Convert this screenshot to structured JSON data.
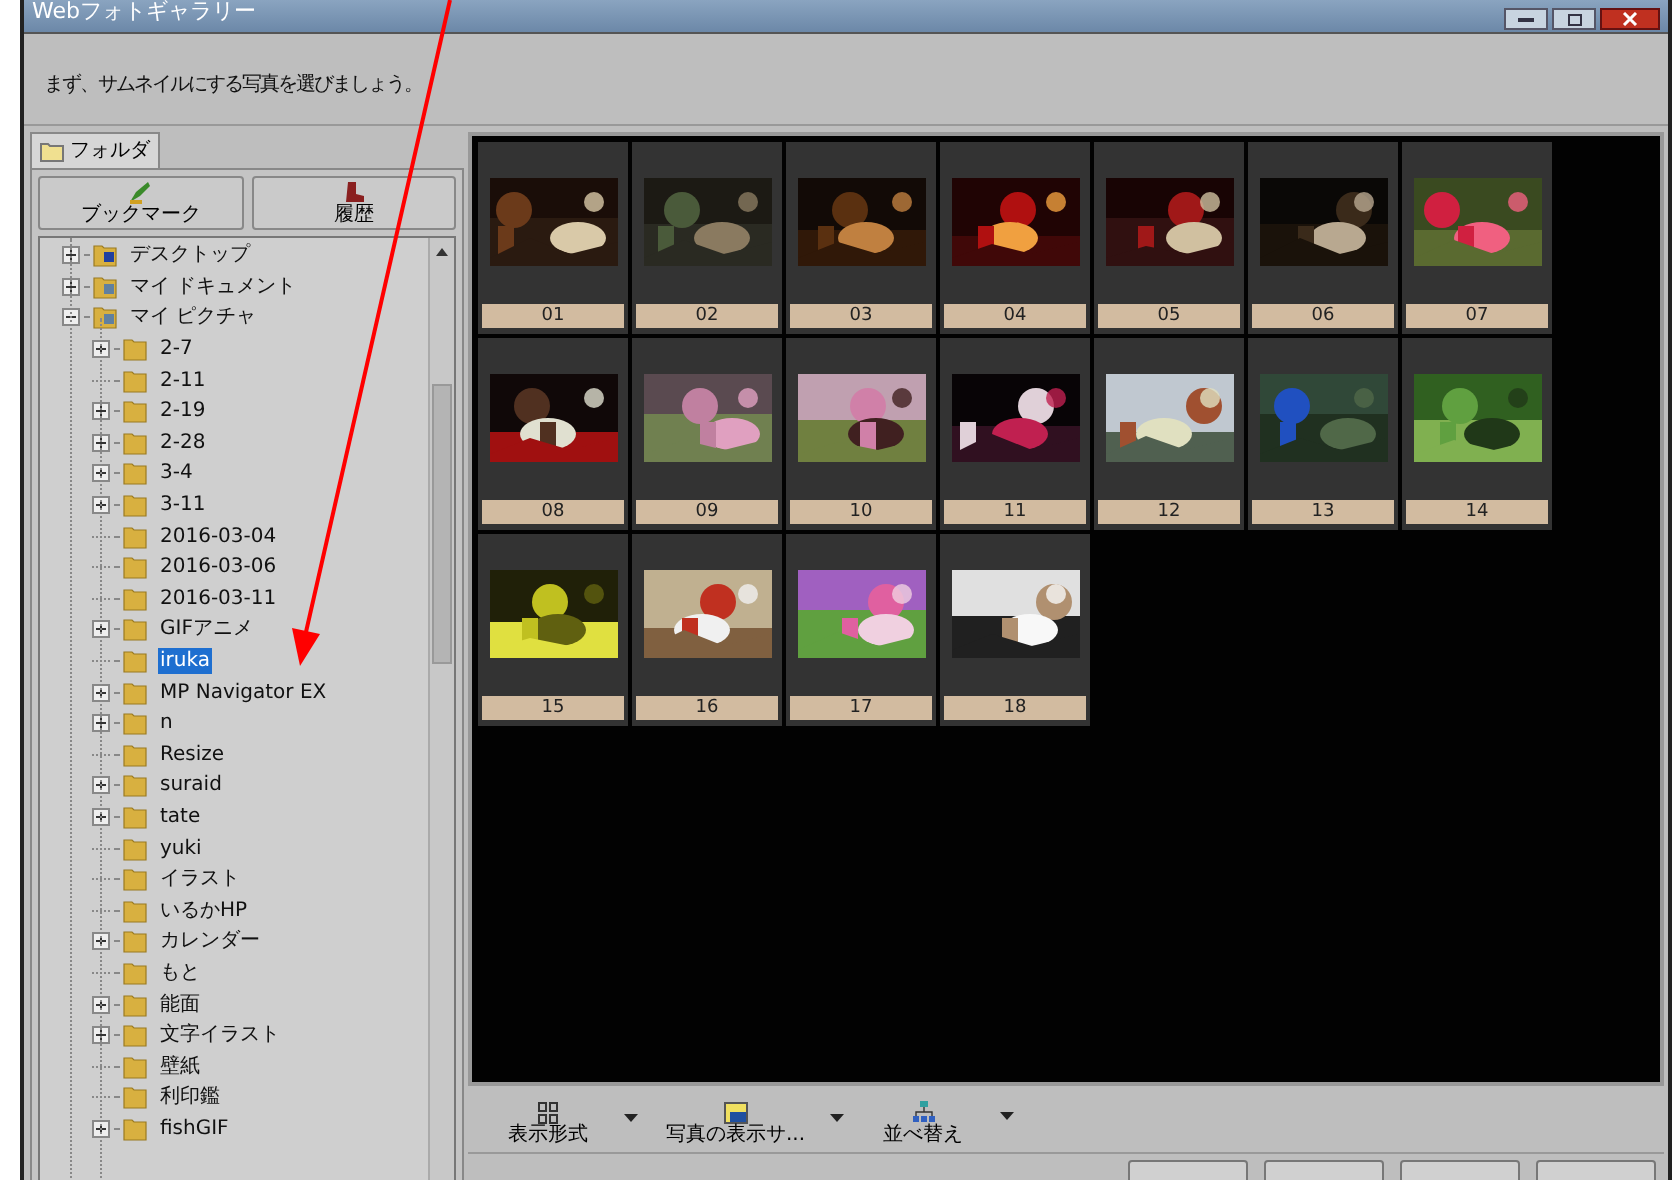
{
  "window": {
    "title": "Webフォトギャラリー"
  },
  "instruction": "まず、サムネイルにする写真を選びましょう。",
  "panel_tab": {
    "label": "フォルダ",
    "selected": true
  },
  "panel_buttons": [
    {
      "label": "ブックマーク",
      "kind": "bookmark"
    },
    {
      "label": "履歴",
      "kind": "history"
    }
  ],
  "tree": [
    {
      "label": "デスクトップ",
      "expandable": true,
      "expanded": false,
      "selected": false,
      "kind": "desktop"
    },
    {
      "label": "マイ ドキュメント",
      "expandable": true,
      "expanded": false,
      "selected": false,
      "kind": "documents"
    },
    {
      "label": "マイ ピクチャ",
      "expandable": true,
      "expanded": true,
      "selected": false,
      "kind": "pictures",
      "children": [
        {
          "label": "2-7",
          "expandable": true,
          "selected": false
        },
        {
          "label": "2-11",
          "expandable": false,
          "selected": false
        },
        {
          "label": "2-19",
          "expandable": true,
          "selected": false
        },
        {
          "label": "2-28",
          "expandable": true,
          "selected": false
        },
        {
          "label": "3-4",
          "expandable": true,
          "selected": false
        },
        {
          "label": "3-11",
          "expandable": true,
          "selected": false
        },
        {
          "label": "2016-03-04",
          "expandable": false,
          "selected": false
        },
        {
          "label": "2016-03-06",
          "expandable": false,
          "selected": false
        },
        {
          "label": "2016-03-11",
          "expandable": false,
          "selected": false
        },
        {
          "label": "GIFアニメ",
          "expandable": true,
          "selected": false
        },
        {
          "label": "iruka",
          "expandable": false,
          "selected": true
        },
        {
          "label": "MP Navigator EX",
          "expandable": true,
          "selected": false
        },
        {
          "label": "n",
          "expandable": true,
          "selected": false
        },
        {
          "label": "Resize",
          "expandable": false,
          "selected": false
        },
        {
          "label": "suraid",
          "expandable": true,
          "selected": false
        },
        {
          "label": "tate",
          "expandable": true,
          "selected": false
        },
        {
          "label": "yuki",
          "expandable": false,
          "selected": false
        },
        {
          "label": "イラスト",
          "expandable": false,
          "selected": false
        },
        {
          "label": "いるかHP",
          "expandable": false,
          "selected": false
        },
        {
          "label": "カレンダー",
          "expandable": true,
          "selected": false
        },
        {
          "label": "もと",
          "expandable": false,
          "selected": false
        },
        {
          "label": "能面",
          "expandable": true,
          "selected": false
        },
        {
          "label": "文字イラスト",
          "expandable": true,
          "selected": false
        },
        {
          "label": "壁紙",
          "expandable": false,
          "selected": false
        },
        {
          "label": "利印鑑",
          "expandable": false,
          "selected": false
        },
        {
          "label": "fishGIF",
          "expandable": true,
          "selected": false
        }
      ]
    }
  ],
  "thumbnails": [
    {
      "caption": "01"
    },
    {
      "caption": "02"
    },
    {
      "caption": "03"
    },
    {
      "caption": "04"
    },
    {
      "caption": "05"
    },
    {
      "caption": "06"
    },
    {
      "caption": "07"
    },
    {
      "caption": "08"
    },
    {
      "caption": "09"
    },
    {
      "caption": "10"
    },
    {
      "caption": "11"
    },
    {
      "caption": "12"
    },
    {
      "caption": "13"
    },
    {
      "caption": "14"
    },
    {
      "caption": "15"
    },
    {
      "caption": "16"
    },
    {
      "caption": "17"
    },
    {
      "caption": "18"
    }
  ],
  "toolbar": [
    {
      "label": "表示形式",
      "kind": "view"
    },
    {
      "label": "写真の表示サ...",
      "kind": "size"
    },
    {
      "label": "並べ替え",
      "kind": "sort"
    }
  ]
}
